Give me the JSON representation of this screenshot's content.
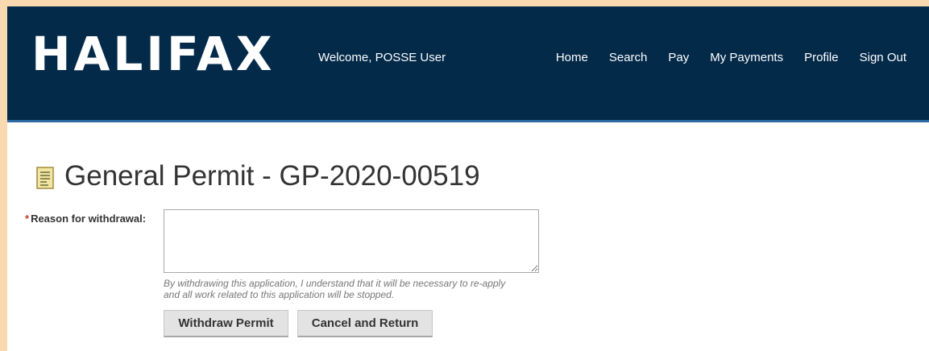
{
  "header": {
    "logo_text": "HALIFAX",
    "welcome": "Welcome, POSSE User",
    "nav": [
      "Home",
      "Search",
      "Pay",
      "My Payments",
      "Profile",
      "Sign Out"
    ]
  },
  "page": {
    "title": "General Permit - GP-2020-00519",
    "title_icon": "document-icon"
  },
  "form": {
    "required_marker": "*",
    "reason_label": "Reason for withdrawal:",
    "reason_value": "",
    "help_line1": "By withdrawing this application, I understand that it will be necessary to re-apply",
    "help_line2": "and all work related to this application will be stopped."
  },
  "buttons": {
    "withdraw": "Withdraw Permit",
    "cancel": "Cancel and Return"
  },
  "colors": {
    "header_bg": "#042a4a",
    "header_border": "#2f6aa6",
    "required": "#c0392b"
  }
}
